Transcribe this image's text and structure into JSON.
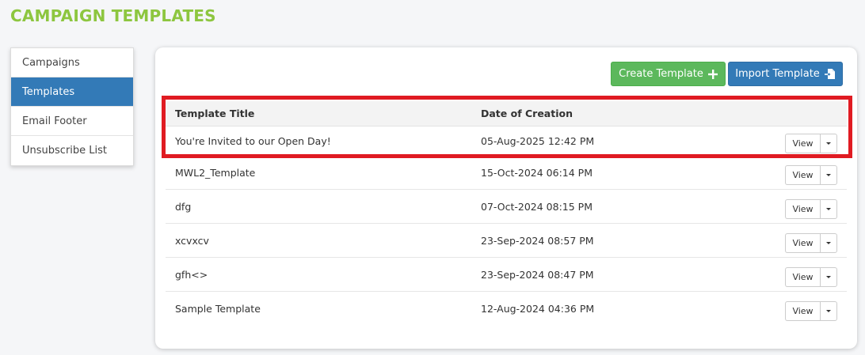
{
  "page": {
    "title": "CAMPAIGN TEMPLATES"
  },
  "sidebar": {
    "items": [
      {
        "label": "Campaigns",
        "active": false
      },
      {
        "label": "Templates",
        "active": true
      },
      {
        "label": "Email Footer",
        "active": false
      },
      {
        "label": "Unsubscribe List",
        "active": false
      }
    ]
  },
  "toolbar": {
    "create_label": "Create Template",
    "create_icon": "plus-icon",
    "import_label": "Import Template",
    "import_icon": "file-import-icon"
  },
  "table": {
    "columns": [
      "Template Title",
      "Date of Creation"
    ],
    "view_label": "View",
    "rows": [
      {
        "title": "You're Invited to our Open Day!",
        "date": "05-Aug-2025 12:42 PM"
      },
      {
        "title": "MWL2_Template",
        "date": "15-Oct-2024 06:14 PM"
      },
      {
        "title": "dfg",
        "date": "07-Oct-2024 08:15 PM"
      },
      {
        "title": "xcvxcv",
        "date": "23-Sep-2024 08:57 PM"
      },
      {
        "title": "gfh<>",
        "date": "23-Sep-2024 08:47 PM"
      },
      {
        "title": "Sample Template",
        "date": "12-Aug-2024 04:36 PM"
      }
    ]
  },
  "colors": {
    "title": "#8dc63f",
    "active_nav": "#337ab7",
    "create_button": "#5cb85c",
    "import_button": "#337ab7",
    "highlight_border": "#e01b22"
  }
}
